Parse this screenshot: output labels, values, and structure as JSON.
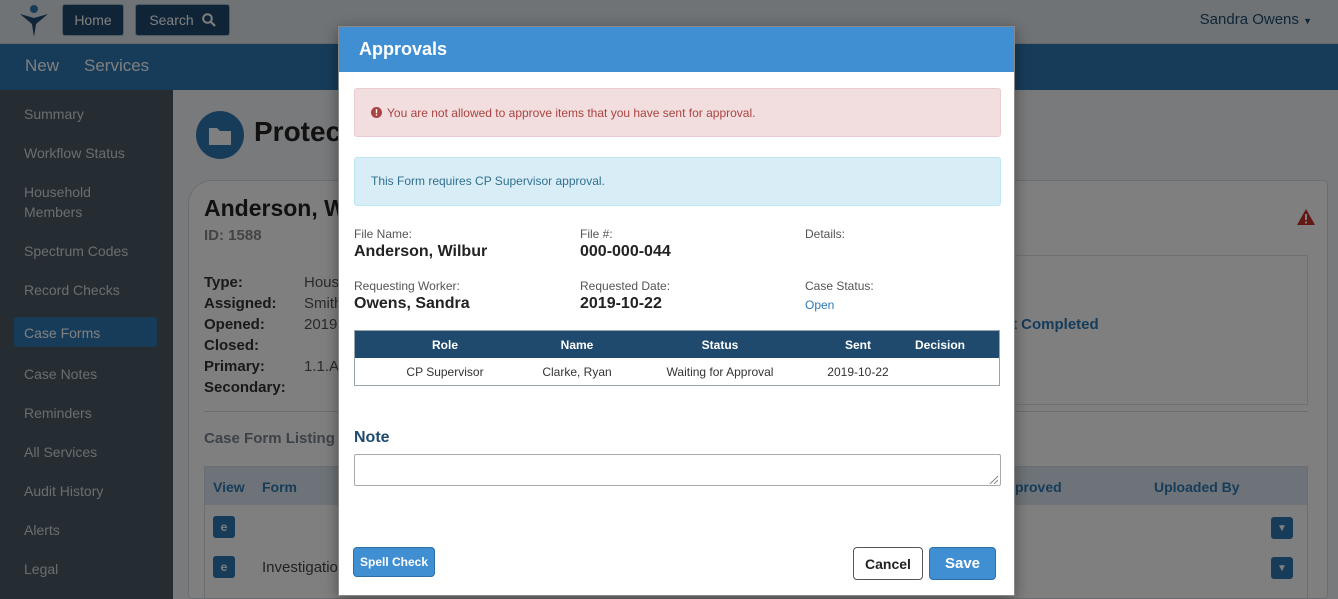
{
  "topbar": {
    "home_label": "Home",
    "search_label": "Search",
    "user_name": "Sandra Owens"
  },
  "navbar": {
    "items": [
      "New",
      "Services"
    ]
  },
  "sidebar": {
    "items": [
      "Summary",
      "Workflow Status",
      "Household Members",
      "Spectrum Codes",
      "Record Checks",
      "Case Forms",
      "Case Notes",
      "Reminders",
      "All Services",
      "Audit History",
      "Alerts",
      "Legal"
    ],
    "active": "Case Forms"
  },
  "background": {
    "page_title": "Protec",
    "client_name": "Anderson, W",
    "client_id": "ID: 1588",
    "fields": [
      {
        "label": "Type:",
        "value": "Hous"
      },
      {
        "label": "Assigned:",
        "value": "Smith"
      },
      {
        "label": "Opened:",
        "value": "2019"
      },
      {
        "label": "Closed:",
        "value": ""
      },
      {
        "label": "Primary:",
        "value": "1.1.A"
      },
      {
        "label": "Secondary:",
        "value": ""
      }
    ],
    "completed_text": "t Completed",
    "listing_title": "Case Form Listing",
    "listing_columns": [
      "View",
      "Form",
      "proved",
      "Uploaded By"
    ],
    "listing_rows": [
      {
        "form": ""
      },
      {
        "form": "Investigatio"
      }
    ]
  },
  "modal": {
    "title": "Approvals",
    "error_message": "You are not allowed to approve items that you have sent for approval.",
    "info_message": "This Form requires CP Supervisor approval.",
    "file_name_label": "File Name:",
    "file_name": "Anderson, Wilbur",
    "file_no_label": "File #:",
    "file_no": "000-000-044",
    "details_label": "Details:",
    "requesting_worker_label": "Requesting Worker:",
    "requesting_worker": "Owens, Sandra",
    "requested_date_label": "Requested Date:",
    "requested_date": "2019-10-22",
    "case_status_label": "Case Status:",
    "case_status": "Open",
    "table": {
      "columns": [
        "Role",
        "Name",
        "Status",
        "Sent",
        "Decision"
      ],
      "rows": [
        {
          "role": "CP Supervisor",
          "name": "Clarke, Ryan",
          "status": "Waiting for Approval",
          "sent": "2019-10-22",
          "decision": ""
        }
      ]
    },
    "note_label": "Note",
    "note_value": "",
    "spell_check_label": "Spell Check",
    "cancel_label": "Cancel",
    "save_label": "Save"
  }
}
